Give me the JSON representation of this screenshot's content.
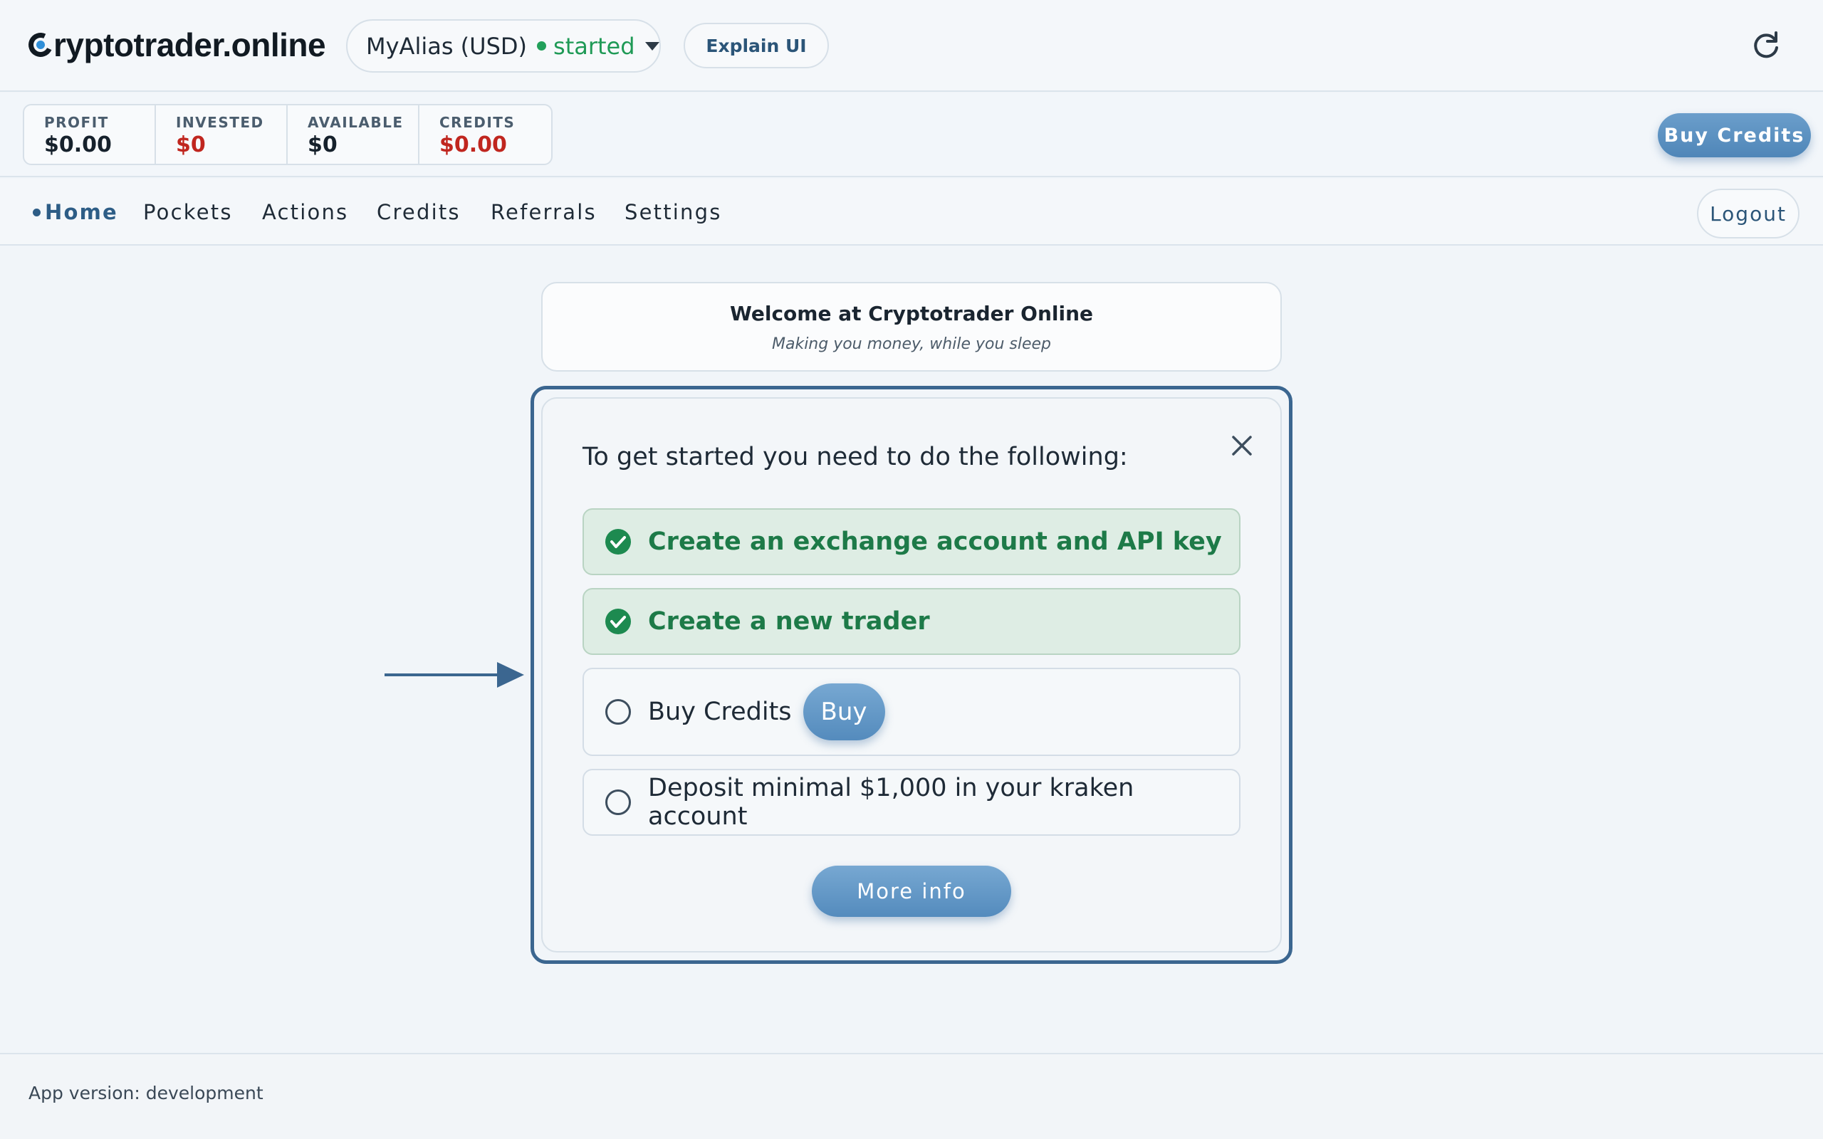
{
  "header": {
    "brand": "Cryptotrader.online",
    "brand_rest": "ryptotrader.online",
    "trader_select": {
      "alias": "MyAlias (USD)",
      "status": "started",
      "status_color": "#1f9a56"
    },
    "explain_label": "Explain UI"
  },
  "stats": [
    {
      "label": "PROFIT",
      "value": "$0.00",
      "color": "#16212c"
    },
    {
      "label": "INVESTED",
      "value": "$0",
      "color": "#c0261f"
    },
    {
      "label": "AVAILABLE",
      "value": "$0",
      "color": "#16212c"
    },
    {
      "label": "CREDITS",
      "value": "$0.00",
      "color": "#c0261f"
    }
  ],
  "buy_credits_label": "Buy Credits",
  "nav": {
    "items": [
      {
        "label": "Home",
        "active": true
      },
      {
        "label": "Pockets",
        "active": false
      },
      {
        "label": "Actions",
        "active": false
      },
      {
        "label": "Credits",
        "active": false
      },
      {
        "label": "Referrals",
        "active": false
      },
      {
        "label": "Settings",
        "active": false
      }
    ],
    "logout_label": "Logout"
  },
  "welcome": {
    "title": "Welcome at Cryptotrader Online",
    "subtitle": "Making you money, while you sleep"
  },
  "onboarding": {
    "title": "To get started you need to do the following:",
    "steps": [
      {
        "label": "Create an exchange account and API key",
        "done": true,
        "icon": "check-circle-icon"
      },
      {
        "label": "Create a new trader",
        "done": true,
        "icon": "check-circle-icon"
      },
      {
        "label": "Buy Credits",
        "done": false,
        "icon": "empty-circle-icon",
        "action": "Buy"
      },
      {
        "label": "Deposit minimal $1,000 in your kraken account",
        "done": false,
        "icon": "empty-circle-icon"
      }
    ],
    "more_info_label": "More info"
  },
  "footer": {
    "version_text": "App version: development"
  },
  "colors": {
    "accent": "#4f86b8",
    "success": "#1d7a48",
    "danger": "#c0261f",
    "frame": "#3b6690"
  }
}
